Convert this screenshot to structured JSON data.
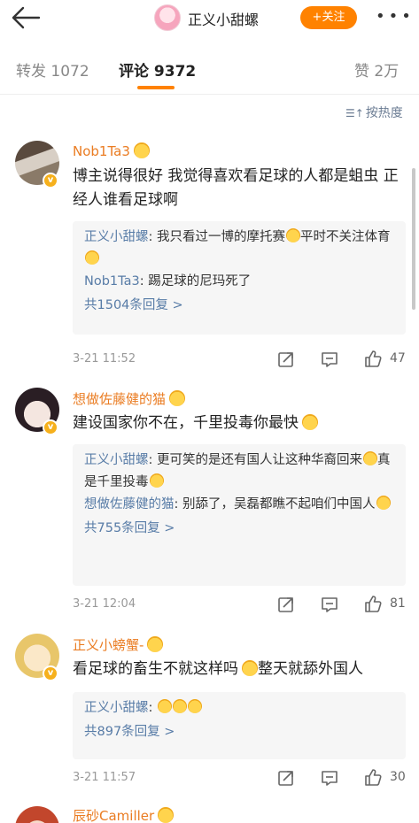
{
  "header": {
    "back_icon": "back-arrow-icon",
    "title": "正义小甜螺",
    "follow_label": "+关注",
    "more_icon": "more-dots-icon",
    "accent": "#ff8200"
  },
  "tabs": {
    "repost": "转发 1072",
    "comment": "评论 9372",
    "like": "赞 2万"
  },
  "sort": {
    "icon": "sort-icon",
    "label": "按热度"
  },
  "comments": [
    {
      "user": "Nob1Ta3",
      "content": "博主说得很好 我觉得喜欢看足球的人都是蛆虫 正经人谁看足球啊",
      "replies": [
        {
          "name": "正义小甜螺",
          "text": ": 我只看过一博的摩托赛",
          "text2": "平时不关注体育"
        },
        {
          "name": "Nob1Ta3",
          "text": ": 踢足球的尼玛死了",
          "text2": ""
        }
      ],
      "reply_count": "共1504条回复 >",
      "time": "3-21 11:52",
      "likes": "47"
    },
    {
      "user": "想做佐藤健的猫",
      "content": "建设国家你不在，千里投毒你最快",
      "replies": [
        {
          "name": "正义小甜螺",
          "text": ": 更可笑的是还有国人让这种华裔回来",
          "text2": "真是千里投毒"
        },
        {
          "name": "想做佐藤健的猫",
          "text": ": 别舔了，吴磊都瞧不起咱们中国人",
          "text2": ""
        }
      ],
      "reply_count": "共755条回复 >",
      "time": "3-21 12:04",
      "likes": "81"
    },
    {
      "user": "正义小螃蟹-",
      "content": "看足球的畜生不就这样吗",
      "content2": "整天就舔外国人",
      "replies": [
        {
          "name": "正义小甜螺",
          "text": ": ",
          "text2": ""
        }
      ],
      "reply_count": "共897条回复 >",
      "time": "3-21 11:57",
      "likes": "30"
    },
    {
      "user": "辰砂Camiller"
    }
  ]
}
